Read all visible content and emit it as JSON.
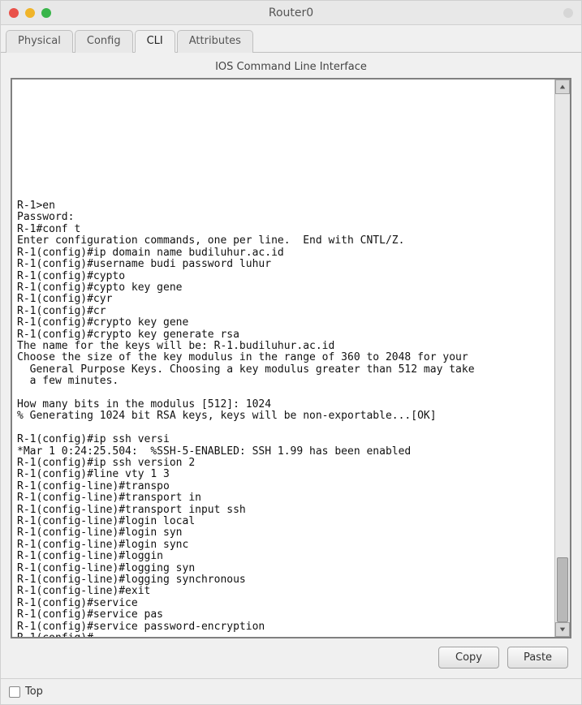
{
  "window": {
    "title": "Router0"
  },
  "tabs": [
    {
      "label": "Physical"
    },
    {
      "label": "Config"
    },
    {
      "label": "CLI"
    },
    {
      "label": "Attributes"
    }
  ],
  "active_tab_index": 2,
  "cli": {
    "title": "IOS Command Line Interface",
    "output": "\n\n\n\n\n\n\n\n\n\nR-1>en\nPassword:\nR-1#conf t\nEnter configuration commands, one per line.  End with CNTL/Z.\nR-1(config)#ip domain name budiluhur.ac.id\nR-1(config)#username budi password luhur\nR-1(config)#cypto\nR-1(config)#cypto key gene\nR-1(config)#cyr\nR-1(config)#cr\nR-1(config)#crypto key gene\nR-1(config)#crypto key generate rsa\nThe name for the keys will be: R-1.budiluhur.ac.id\nChoose the size of the key modulus in the range of 360 to 2048 for your\n  General Purpose Keys. Choosing a key modulus greater than 512 may take\n  a few minutes.\n\nHow many bits in the modulus [512]: 1024\n% Generating 1024 bit RSA keys, keys will be non-exportable...[OK]\n\nR-1(config)#ip ssh versi\n*Mar 1 0:24:25.504:  %SSH-5-ENABLED: SSH 1.99 has been enabled\nR-1(config)#ip ssh version 2\nR-1(config)#line vty 1 3\nR-1(config-line)#transpo\nR-1(config-line)#transport in\nR-1(config-line)#transport input ssh\nR-1(config-line)#login local\nR-1(config-line)#login syn\nR-1(config-line)#login sync\nR-1(config-line)#loggin\nR-1(config-line)#logging syn\nR-1(config-line)#logging synchronous\nR-1(config-line)#exit\nR-1(config)#service\nR-1(config)#service pas\nR-1(config)#service password-encryption\nR-1(config)#"
  },
  "buttons": {
    "copy": "Copy",
    "paste": "Paste"
  },
  "footer": {
    "top_label": "Top",
    "top_checked": false
  }
}
